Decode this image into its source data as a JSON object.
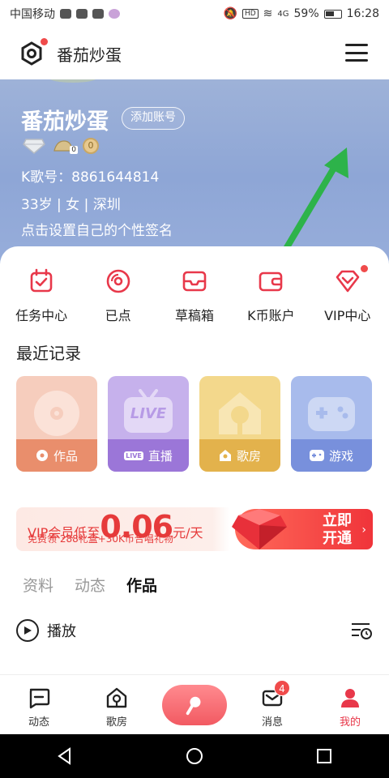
{
  "status_bar": {
    "carrier": "中国移动",
    "network": "4G",
    "battery_percent": "59%",
    "time": "16:28"
  },
  "header": {
    "title": "番茄炒蛋",
    "menu_icon": "hamburger-menu-icon"
  },
  "profile": {
    "nickname": "番茄炒蛋",
    "add_account_label": "添加账号",
    "badge_coin_text": "0",
    "badge_hat_text": "0",
    "k_id_line": "K歌号：8861644814",
    "details_line": "33岁 | 女 | 深圳",
    "signature_placeholder": "点击设置自己的个性签名"
  },
  "quick_actions": [
    {
      "label": "任务中心",
      "icon": "calendar-check-icon"
    },
    {
      "label": "已点",
      "icon": "disc-icon"
    },
    {
      "label": "草稿箱",
      "icon": "inbox-tray-icon"
    },
    {
      "label": "K币账户",
      "icon": "wallet-icon"
    },
    {
      "label": "VIP中心",
      "icon": "vip-diamond-icon"
    }
  ],
  "recent": {
    "title": "最近记录",
    "tiles": [
      {
        "label": "作品",
        "icon": "record-disc-icon"
      },
      {
        "label": "直播",
        "icon": "live-tv-icon",
        "tag": "LIVE"
      },
      {
        "label": "歌房",
        "icon": "house-icon"
      },
      {
        "label": "游戏",
        "icon": "gamepad-icon"
      }
    ]
  },
  "banner": {
    "prefix": "VIP会员低至",
    "price": "0.06",
    "unit": "元/天",
    "subtitle": "免费领 288礼盒+30K币合唱礼物",
    "cta_line1": "立即",
    "cta_line2": "开通",
    "cta_arrow": "›"
  },
  "tabs": [
    {
      "label": "资料",
      "active": false
    },
    {
      "label": "动态",
      "active": false
    },
    {
      "label": "作品",
      "active": true
    }
  ],
  "play": {
    "label": "播放"
  },
  "bottom_nav": [
    {
      "label": "动态",
      "icon": "chat-bubble-icon"
    },
    {
      "label": "歌房",
      "icon": "house-icon"
    },
    {
      "label": "",
      "icon": "microphone-icon"
    },
    {
      "label": "消息",
      "icon": "envelope-icon",
      "badge": "4"
    },
    {
      "label": "我的",
      "icon": "person-icon",
      "active": true
    }
  ],
  "colors": {
    "accent_red": "#e8384a",
    "profile_bg": "#8ea6d6",
    "annotation_arrow": "#2db34a"
  }
}
